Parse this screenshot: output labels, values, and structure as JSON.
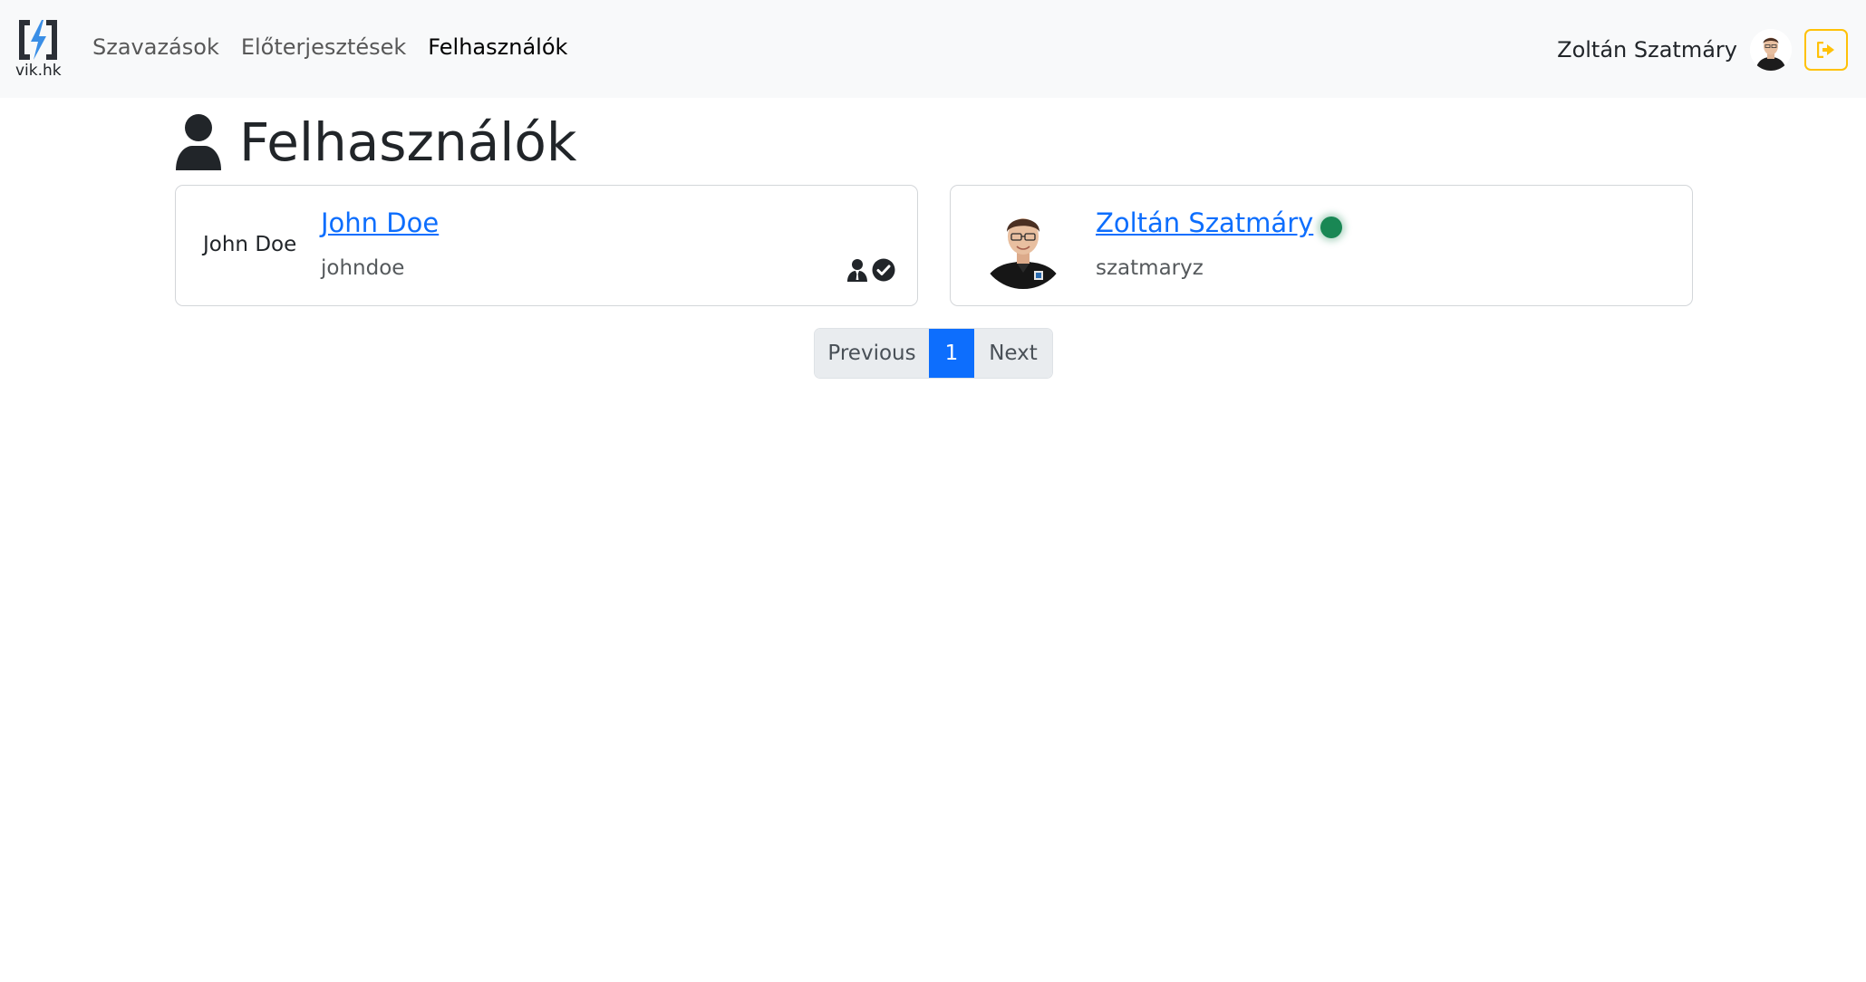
{
  "navbar": {
    "brand_text": "vik.hk",
    "links": [
      "Szavazások",
      "Előterjesztések",
      "Felhasználók"
    ],
    "active_link": "Felhasználók",
    "user_name": "Zoltán Szatmáry"
  },
  "page": {
    "title": "Felhasználók",
    "title_icon": "person-icon"
  },
  "users": [
    {
      "avatar_alt": "John Doe",
      "name": "John Doe",
      "username": "johndoe",
      "badges": [
        "admin-icon",
        "verified-check-icon"
      ]
    },
    {
      "name": "Zoltán Szatmáry",
      "username": "szatmaryz",
      "online": true
    }
  ],
  "pagination": {
    "previous": "Previous",
    "current": "1",
    "next": "Next"
  },
  "colors": {
    "link": "#0d6efd",
    "online": "#198754",
    "logout_border": "#ffc107",
    "navbar_bg": "#f8f9fa"
  }
}
